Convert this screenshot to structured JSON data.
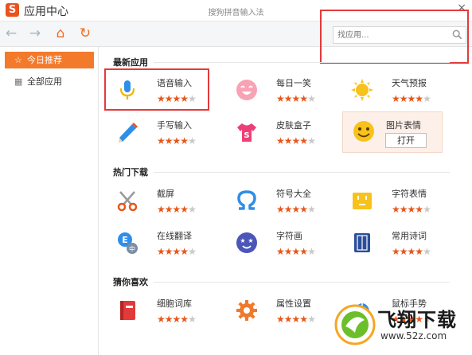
{
  "window": {
    "logo_letter": "S",
    "app_title": "应用中心",
    "window_title": "搜狗拼音输入法",
    "close_symbol": "×"
  },
  "toolbar": {
    "back_symbol": "←",
    "forward_symbol": "→",
    "home_symbol": "⌂",
    "refresh_symbol": "↻"
  },
  "search": {
    "placeholder": "找应用..."
  },
  "sidebar": {
    "items": [
      {
        "label": "今日推荐",
        "icon": "star-icon",
        "icon_glyph": "☆",
        "active": true
      },
      {
        "label": "全部应用",
        "icon": "grid-icon",
        "icon_glyph": "▦",
        "active": false
      }
    ]
  },
  "sections": {
    "new_apps": "最新应用",
    "hot_downloads": "热门下载",
    "guess_you_like": "猜你喜欢"
  },
  "apps": {
    "new": [
      {
        "name": "语音输入",
        "rating": 4
      },
      {
        "name": "每日一笑",
        "rating": 4
      },
      {
        "name": "天气预报",
        "rating": 4
      },
      {
        "name": "手写输入",
        "rating": 4
      },
      {
        "name": "皮肤盒子",
        "rating": 4
      },
      {
        "name": "图片表情",
        "rating": 4,
        "button": "打开"
      }
    ],
    "hot": [
      {
        "name": "截屏",
        "rating": 4
      },
      {
        "name": "符号大全",
        "rating": 4
      },
      {
        "name": "字符表情",
        "rating": 4
      },
      {
        "name": "在线翻译",
        "rating": 4
      },
      {
        "name": "字符画",
        "rating": 4
      },
      {
        "name": "常用诗词",
        "rating": 4
      }
    ],
    "guess": [
      {
        "name": "细胞词库",
        "rating": 4
      },
      {
        "name": "属性设置",
        "rating": 4
      },
      {
        "name": "鼠标手势",
        "rating": 4
      }
    ]
  },
  "star_glyph": "★",
  "watermark": {
    "brand": "飞翔下载",
    "url": "www.52z.com"
  },
  "colors": {
    "accent": "#f47a2b",
    "star_on": "#e8561a",
    "star_off": "#c9c9c9",
    "annotation_red": "#e43a3a"
  }
}
